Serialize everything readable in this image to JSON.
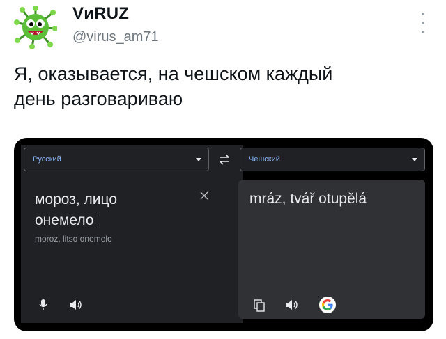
{
  "tweet": {
    "display_name": "VиRUZ",
    "handle": "@virus_am71",
    "text_line1": "Я, оказывается, на чешском каждый",
    "text_line2": "день разговариваю"
  },
  "translate": {
    "source_lang": "Русский",
    "target_lang": "Чешский",
    "source_line1": "мороз, лицо",
    "source_line2": "онемело",
    "transliteration": "moroz, litso onemelo",
    "translation": "mráz, tvář otupělá"
  },
  "colors": {
    "panel": "#202124",
    "panel_output": "#303134",
    "lang_label": "#8ab4f8",
    "avatar": "#5bbf3a"
  },
  "icons": [
    "avatar-virus-icon",
    "more-icon",
    "swap-languages-icon",
    "clear-text-icon",
    "microphone-icon",
    "speaker-icon",
    "copy-icon",
    "google-logo-icon"
  ]
}
